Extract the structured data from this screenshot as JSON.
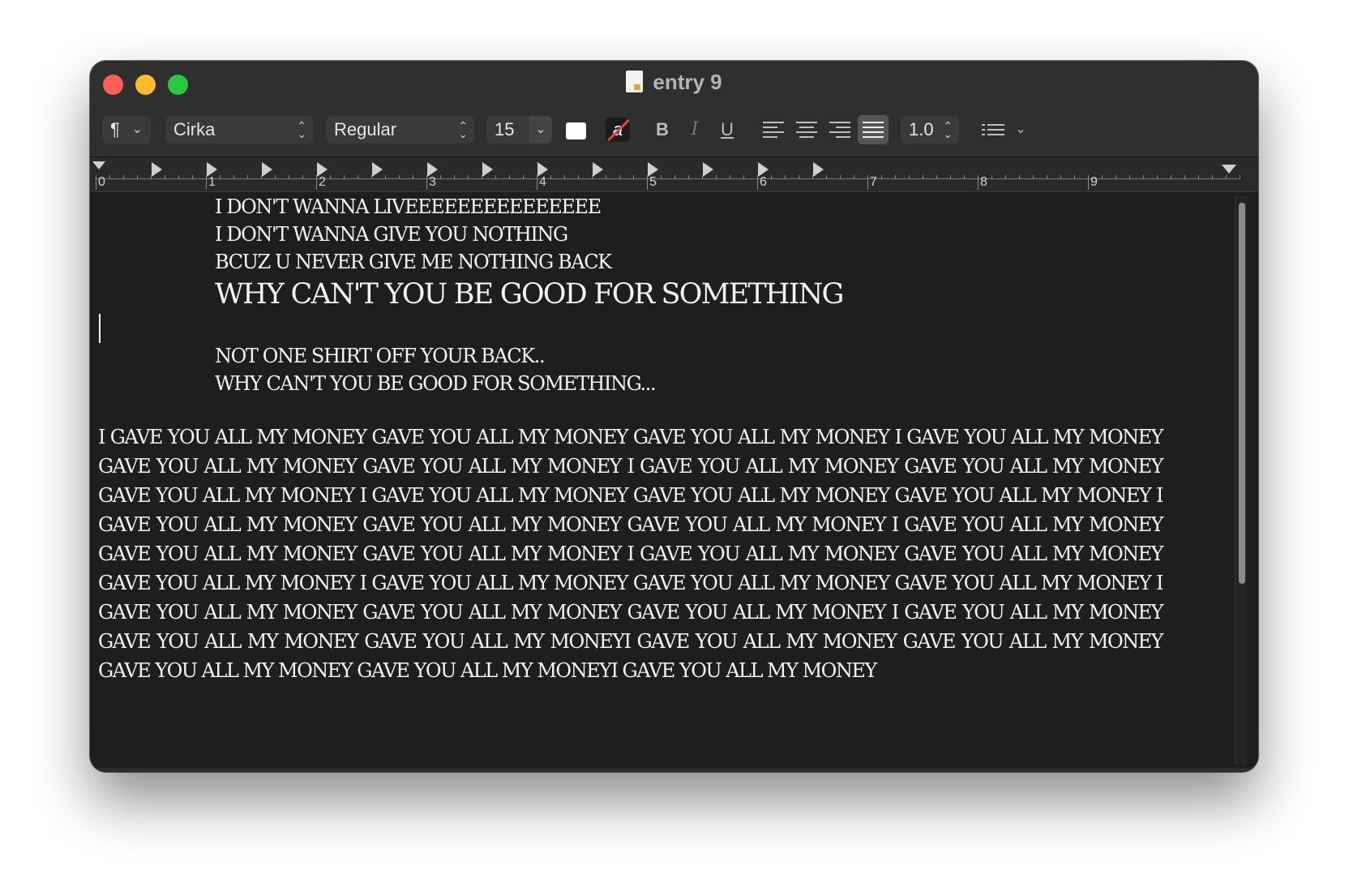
{
  "window": {
    "title": "entry 9"
  },
  "toolbar": {
    "paragraph_style": "¶",
    "font_family": "Cirka",
    "font_style": "Regular",
    "font_size": "15",
    "text_color": "#ffffff",
    "highlight_label": "a",
    "bold_label": "B",
    "italic_label": "I",
    "underline_label": "U",
    "line_spacing": "1.0",
    "active_alignment": "justify"
  },
  "ruler": {
    "numbers": [
      "0",
      "1",
      "2",
      "3",
      "4",
      "5",
      "6",
      "7",
      "8",
      "9"
    ]
  },
  "document": {
    "lines": [
      "I DON'T WANNA LIVEEEEEEEEEEEEEEE",
      "I DON'T WANNA GIVE YOU NOTHING",
      "BCUZ U NEVER GIVE ME NOTHING BACK"
    ],
    "heading": "WHY CAN'T YOU BE GOOD FOR SOMETHING",
    "lines2": [
      "NOT ONE SHIRT OFF YOUR BACK..",
      "WHY CAN'T YOU BE GOOD FOR SOMETHING..."
    ],
    "paragraph": "I GAVE YOU ALL MY MONEY GAVE YOU ALL MY MONEY GAVE YOU ALL MY MONEY I GAVE YOU ALL MY MONEY GAVE YOU ALL MY MONEY GAVE YOU ALL MY MONEY I GAVE YOU ALL MY MONEY GAVE YOU ALL MY MONEY GAVE YOU ALL MY MONEY I GAVE YOU ALL MY MONEY GAVE YOU ALL MY MONEY GAVE YOU ALL MY MONEY I GAVE YOU ALL MY MONEY GAVE YOU ALL MY MONEY GAVE YOU ALL MY MONEY I GAVE YOU ALL MY MONEY GAVE YOU ALL MY MONEY GAVE YOU ALL MY MONEY I GAVE YOU ALL MY MONEY GAVE YOU ALL MY MONEY GAVE YOU ALL MY MONEY I GAVE YOU ALL MY MONEY GAVE YOU ALL MY MONEY GAVE YOU ALL MY MONEY I GAVE YOU ALL MY MONEY GAVE YOU ALL MY MONEY GAVE YOU ALL MY MONEY I GAVE YOU ALL MY MONEY GAVE YOU ALL MY MONEY GAVE YOU ALL MY MONEYI GAVE YOU ALL MY MONEY GAVE YOU ALL MY MONEY GAVE YOU ALL MY MONEY GAVE YOU ALL MY MONEYI GAVE YOU ALL MY MONEY"
  }
}
